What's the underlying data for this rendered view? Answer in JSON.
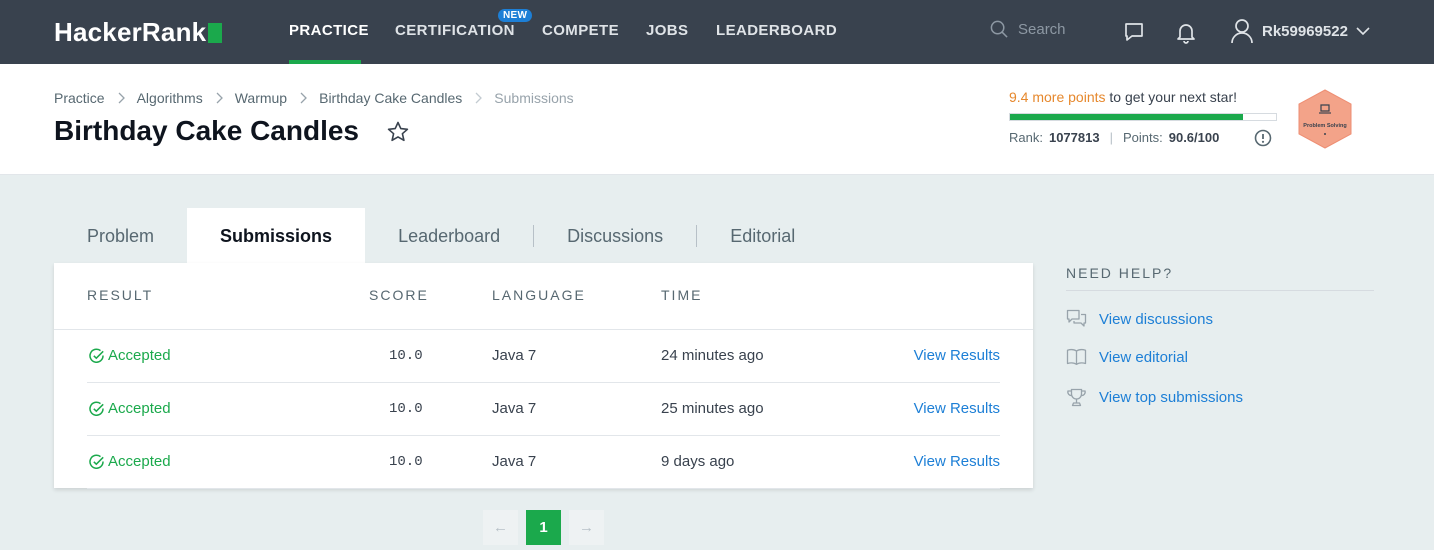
{
  "nav": {
    "logo": "HackerRank",
    "items": [
      "PRACTICE",
      "CERTIFICATION",
      "COMPETE",
      "JOBS",
      "LEADERBOARD"
    ],
    "new_badge": "NEW",
    "search_placeholder": "Search",
    "username": "Rk59969522"
  },
  "breadcrumb": [
    "Practice",
    "Algorithms",
    "Warmup",
    "Birthday Cake Candles",
    "Submissions"
  ],
  "title": "Birthday Cake Candles",
  "progress": {
    "points_needed": "9.4 more points",
    "message": " to get your next star!",
    "fill_fraction": 0.876,
    "rank_label": "Rank:",
    "rank_value": "1077813",
    "points_label": "Points:",
    "points_value": "90.6/100",
    "badge_label": "Problem Solving"
  },
  "tabs": [
    "Problem",
    "Submissions",
    "Leaderboard",
    "Discussions",
    "Editorial"
  ],
  "table": {
    "headers": [
      "RESULT",
      "SCORE",
      "LANGUAGE",
      "TIME"
    ],
    "rows": [
      {
        "result": "Accepted",
        "score": "10.0",
        "language": "Java 7",
        "time": "24 minutes ago",
        "action": "View Results"
      },
      {
        "result": "Accepted",
        "score": "10.0",
        "language": "Java 7",
        "time": "25 minutes ago",
        "action": "View Results"
      },
      {
        "result": "Accepted",
        "score": "10.0",
        "language": "Java 7",
        "time": "9 days ago",
        "action": "View Results"
      }
    ]
  },
  "pagination": {
    "prev": "←",
    "current": "1",
    "next": "→"
  },
  "help": {
    "title": "NEED HELP?",
    "links": [
      "View discussions",
      "View editorial",
      "View top submissions"
    ]
  },
  "colors": {
    "accent": "#1ba94c",
    "link": "#1d7fd6",
    "nav_bg": "#39424e",
    "points_highlight": "#e6882d"
  }
}
